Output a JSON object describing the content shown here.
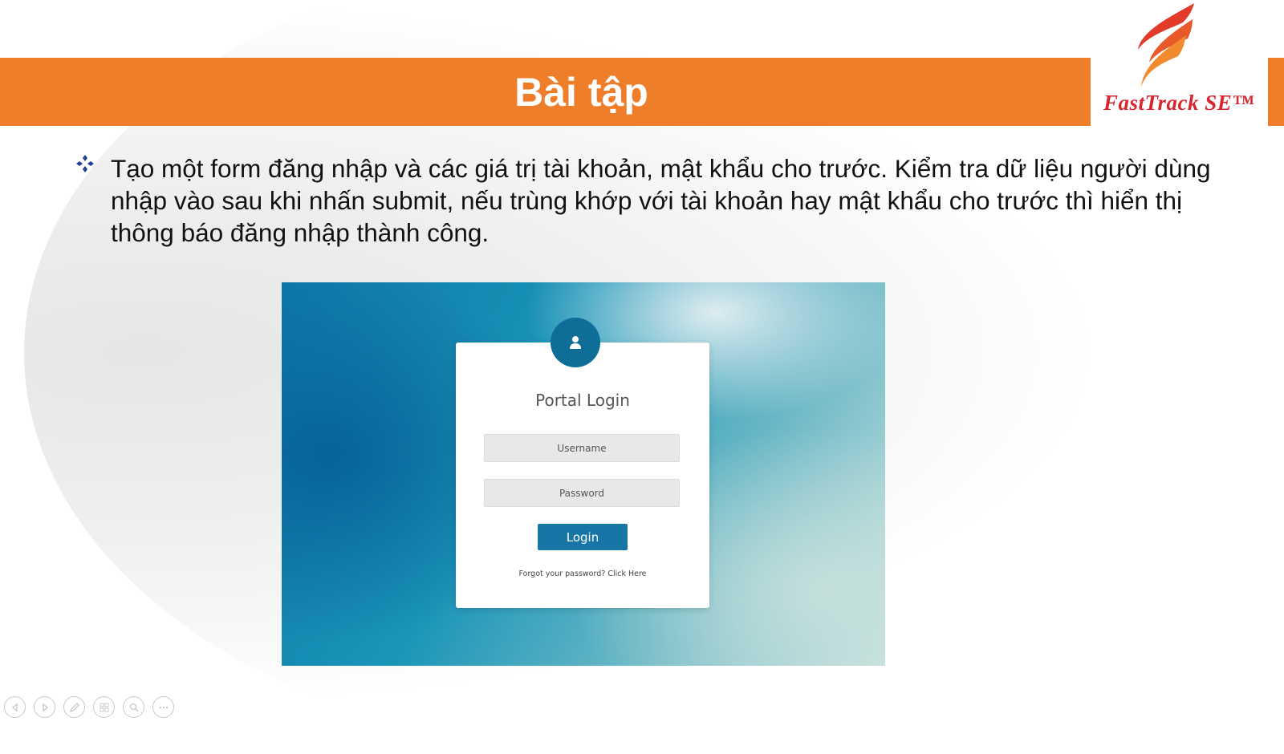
{
  "slide": {
    "title": "Bài tập",
    "logo_text": "FastTrack SE™",
    "bullet_text": "Tạo một form đăng nhập và các giá trị tài khoản, mật khẩu cho trước. Kiểm tra dữ liệu người dùng nhập vào sau khi nhấn submit, nếu trùng khớp với tài khoản hay mật khẩu cho trước thì hiển thị thông báo đăng nhập thành công."
  },
  "login_form": {
    "title": "Portal Login",
    "username_placeholder": "Username",
    "password_placeholder": "Password",
    "login_label": "Login",
    "forgot_text": "Forgot your password? Click Here"
  },
  "colors": {
    "title_bar": "#ef7e2b",
    "bullet": "#1f3f97",
    "logo_red": "#d8262e",
    "login_button": "#1776a6"
  },
  "controls": [
    "previous-icon",
    "next-icon",
    "pen-icon",
    "slides-icon",
    "zoom-icon",
    "more-icon"
  ]
}
